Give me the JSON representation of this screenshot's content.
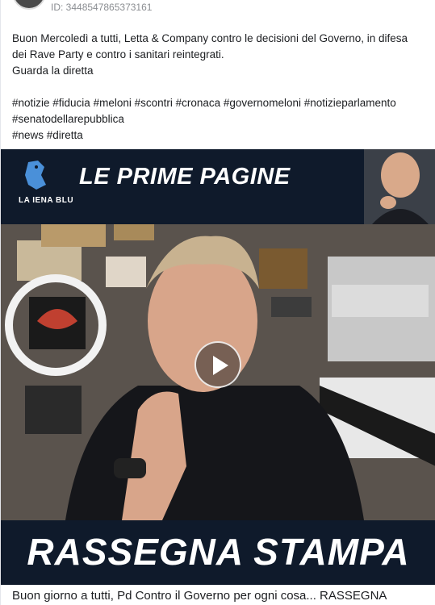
{
  "post": {
    "id_label": "ID: 3448547865373161",
    "text_lines": [
      "Buon Mercoledì a tutti, Letta & Company contro le decisioni del Governo, in difesa",
      "dei Rave Party e contro i sanitari reintegrati.",
      "Guarda la diretta"
    ],
    "hashtag_lines": [
      "#notizie #fiducia #meloni #scontri #cronaca #governomeloni #notizieparlamento",
      "#senatodellarepubblica",
      "#news #diretta"
    ]
  },
  "video": {
    "logo_text": "LA IENA BLU",
    "headline": "LE PRIME PAGINE",
    "bottom_banner": "RASSEGNA STAMPA",
    "play_icon": "play-icon",
    "colors": {
      "banner_bg": "#0f1a2b",
      "text": "#ffffff"
    }
  },
  "caption": "Buon giorno a tutti, Pd Contro il Governo per ogni cosa... RASSEGNA"
}
